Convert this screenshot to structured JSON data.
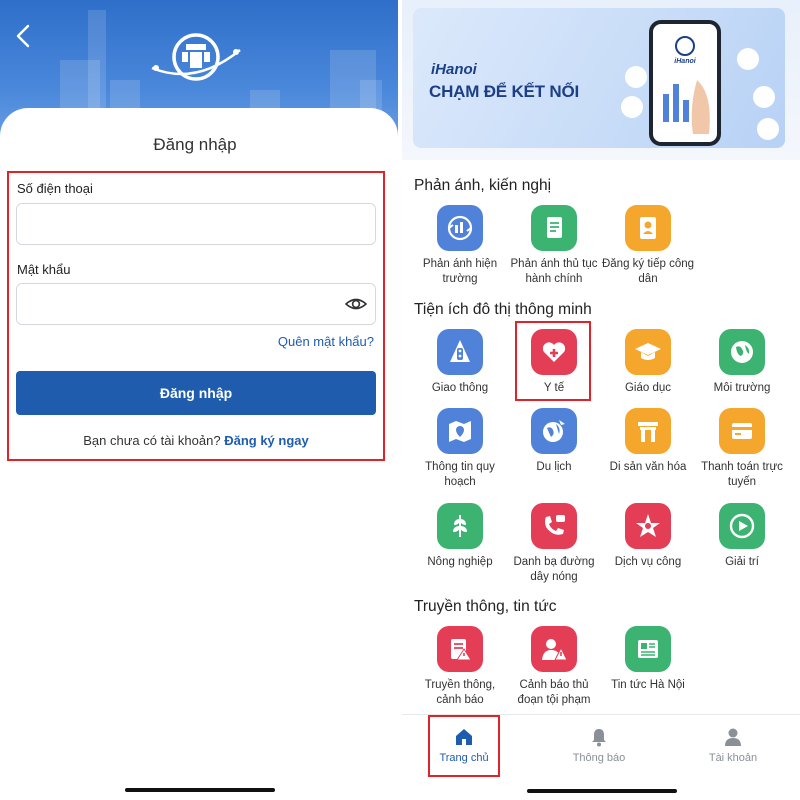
{
  "login": {
    "title": "Đăng nhập",
    "phone_label": "Số điện thoại",
    "phone_value": "",
    "password_label": "Mật khẩu",
    "password_value": "",
    "forgot_link": "Quên mật khẩu?",
    "submit_label": "Đăng nhập",
    "no_account_text": "Bạn chưa có tài khoản?",
    "signup_link": "Đăng ký ngay"
  },
  "banner": {
    "brand": "iHanoi",
    "slogan": "CHẠM ĐỂ KẾT NỐI",
    "phone_brand": "iHanoi"
  },
  "sections": [
    {
      "title": "Phản ánh, kiến nghị",
      "items": [
        {
          "label": "Phản ánh hiện trường",
          "icon": "report-scene-icon",
          "color": "#4f82d8"
        },
        {
          "label": "Phản ánh thủ tục hành chính",
          "icon": "document-icon",
          "color": "#3cb371"
        },
        {
          "label": "Đăng ký tiếp công dân",
          "icon": "citizen-card-icon",
          "color": "#f4a72c"
        }
      ]
    },
    {
      "title": "Tiện ích đô thị thông minh",
      "items": [
        {
          "label": "Giao thông",
          "icon": "traffic-light-icon",
          "color": "#4f82d8"
        },
        {
          "label": "Y tế",
          "icon": "health-heart-icon",
          "color": "#e43e56"
        },
        {
          "label": "Giáo dục",
          "icon": "graduation-cap-icon",
          "color": "#f4a72c"
        },
        {
          "label": "Môi trường",
          "icon": "globe-leaf-icon",
          "color": "#3cb371"
        },
        {
          "label": "Thông tin quy hoạch",
          "icon": "map-pin-icon",
          "color": "#4f82d8"
        },
        {
          "label": "Du lịch",
          "icon": "travel-globe-icon",
          "color": "#4f82d8"
        },
        {
          "label": "Di sản văn hóa",
          "icon": "heritage-gate-icon",
          "color": "#f4a72c"
        },
        {
          "label": "Thanh toán trực tuyến",
          "icon": "payment-card-icon",
          "color": "#f4a72c"
        },
        {
          "label": "Nông nghiệp",
          "icon": "agriculture-icon",
          "color": "#3cb371"
        },
        {
          "label": "Danh bạ đường dây nóng",
          "icon": "hotline-phone-icon",
          "color": "#e43e56"
        },
        {
          "label": "Dịch vụ công",
          "icon": "public-service-icon",
          "color": "#e43e56"
        },
        {
          "label": "Giải trí",
          "icon": "play-icon",
          "color": "#3cb371"
        }
      ]
    },
    {
      "title": "Truyền thông, tin tức",
      "items": [
        {
          "label": "Truyền thông, cảnh báo",
          "icon": "media-alert-icon",
          "color": "#e43e56"
        },
        {
          "label": "Cảnh báo thủ đoạn tội phạm",
          "icon": "crime-warning-icon",
          "color": "#e43e56"
        },
        {
          "label": "Tin tức Hà Nội",
          "icon": "news-icon",
          "color": "#3cb371"
        }
      ]
    }
  ],
  "bottom_nav": [
    {
      "label": "Trang chủ",
      "icon": "home-icon",
      "active": true
    },
    {
      "label": "Thông báo",
      "icon": "bell-icon",
      "active": false
    },
    {
      "label": "Tài khoản",
      "icon": "user-icon",
      "active": false
    }
  ],
  "colors": {
    "primary": "#1f5cae",
    "highlight_border": "#e0232b",
    "header_blue": "#2f6fc9"
  }
}
